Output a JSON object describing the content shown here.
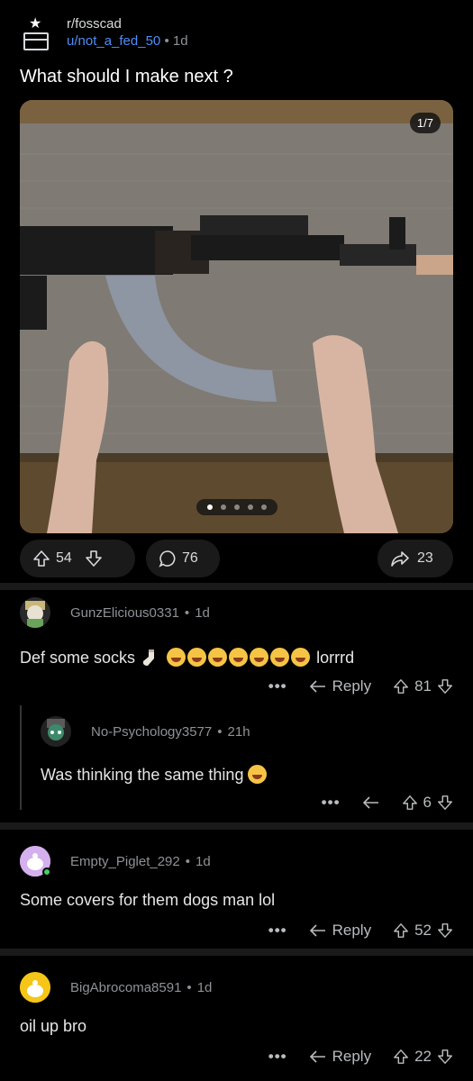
{
  "post": {
    "subreddit": "r/fosscad",
    "author": "u/not_a_fed_50",
    "separator": "•",
    "time": "1d",
    "title": "What should I make next ?",
    "media": {
      "pager": "1/7",
      "dot_count": 5,
      "active_dot": 0
    },
    "upvotes": "54",
    "comments": "76",
    "shares": "23"
  },
  "comments": [
    {
      "user": "GunzElicious0331",
      "time": "1d",
      "text_before": "Def some socks",
      "text_after": "lorrrd",
      "laugh_emoji_count": 7,
      "reply_label": "Reply",
      "votes": "81"
    },
    {
      "user": "No-Psychology3577",
      "time": "21h",
      "text": "Was thinking the same thing",
      "votes": "6"
    },
    {
      "user": "Empty_Piglet_292",
      "time": "1d",
      "text": "Some covers for them dogs man lol",
      "reply_label": "Reply",
      "votes": "52"
    },
    {
      "user": "BigAbrocoma8591",
      "time": "1d",
      "text": "oil up bro",
      "reply_label": "Reply",
      "votes": "22"
    }
  ],
  "common": {
    "more": "•••",
    "separator": "•"
  },
  "colors": {
    "background": "#000000",
    "link": "#4f8ef7",
    "muted": "#8e9297",
    "online": "#46d160"
  }
}
